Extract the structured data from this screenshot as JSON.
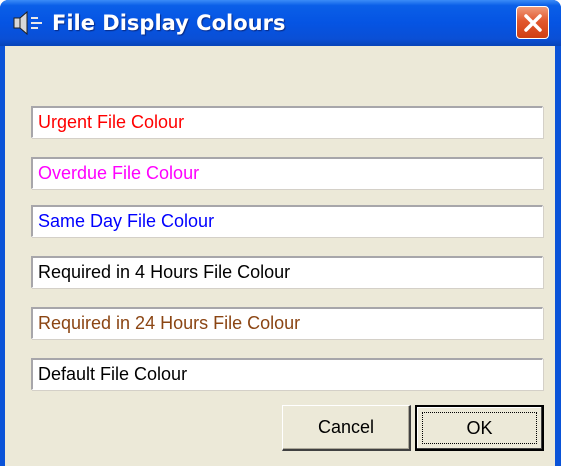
{
  "window": {
    "title": "File Display Colours",
    "app_icon": "speaker-icon",
    "close_icon": "close-icon"
  },
  "fields": [
    {
      "label": "Urgent File Colour",
      "color": "#ff0000"
    },
    {
      "label": "Overdue File Colour",
      "color": "#ff00ff"
    },
    {
      "label": "Same Day File Colour",
      "color": "#0000ff"
    },
    {
      "label": "Required in 4 Hours File Colour",
      "color": "#000000"
    },
    {
      "label": "Required in 24 Hours File Colour",
      "color": "#8b4513"
    },
    {
      "label": "Default File Colour",
      "color": "#000000"
    }
  ],
  "buttons": {
    "cancel": "Cancel",
    "ok": "OK"
  }
}
